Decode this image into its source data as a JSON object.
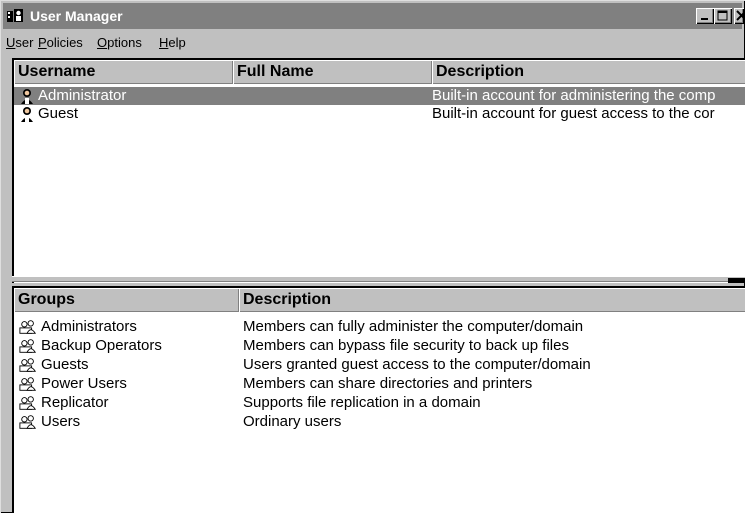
{
  "window": {
    "title": "User Manager"
  },
  "menu": {
    "items": [
      "User",
      "Policies",
      "Options",
      "Help"
    ]
  },
  "users_table": {
    "headers": [
      "Username",
      "Full Name",
      "Description"
    ],
    "rows": [
      {
        "username": "Administrator",
        "full_name": "",
        "description": "Built-in account for administering the comp",
        "selected": true
      },
      {
        "username": "Guest",
        "full_name": "",
        "description": "Built-in account for guest access to the cor",
        "selected": false
      }
    ]
  },
  "groups_table": {
    "headers": [
      "Groups",
      "Description"
    ],
    "rows": [
      {
        "group": "Administrators",
        "description": "Members can fully administer the computer/domain"
      },
      {
        "group": "Backup Operators",
        "description": "Members can bypass file security to back up files"
      },
      {
        "group": "Guests",
        "description": "Users granted guest access to the computer/domain"
      },
      {
        "group": "Power Users",
        "description": "Members can share directories and printers"
      },
      {
        "group": "Replicator",
        "description": "Supports file replication in a domain"
      },
      {
        "group": "Users",
        "description": "Ordinary users"
      }
    ]
  },
  "colors": {
    "titlebar": "#808080",
    "selection": "#808080",
    "face": "#c0c0c0"
  },
  "icons": {
    "app": "user-manager-icon",
    "user": "user-icon",
    "group": "group-icon"
  }
}
